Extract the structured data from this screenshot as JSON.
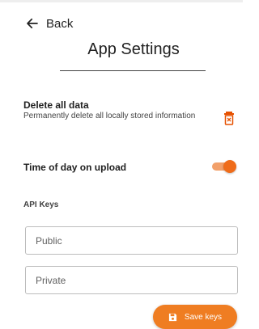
{
  "header": {
    "back_label": "Back",
    "back_icon": "arrow-left-icon",
    "title": "App Settings"
  },
  "settings": {
    "delete_data": {
      "title": "Delete all data",
      "description": "Permanently delete all locally stored information",
      "icon": "trash-icon",
      "icon_color": "#e65100"
    },
    "time_of_day": {
      "title": "Time of day on upload",
      "enabled": true,
      "toggle_color": "#ef6c1a"
    }
  },
  "api_keys": {
    "section_label": "API Keys",
    "public_placeholder": "Public",
    "private_placeholder": "Private"
  },
  "actions": {
    "save_label": "Save keys",
    "save_icon": "save-icon",
    "accent_color": "#ef7d22"
  }
}
